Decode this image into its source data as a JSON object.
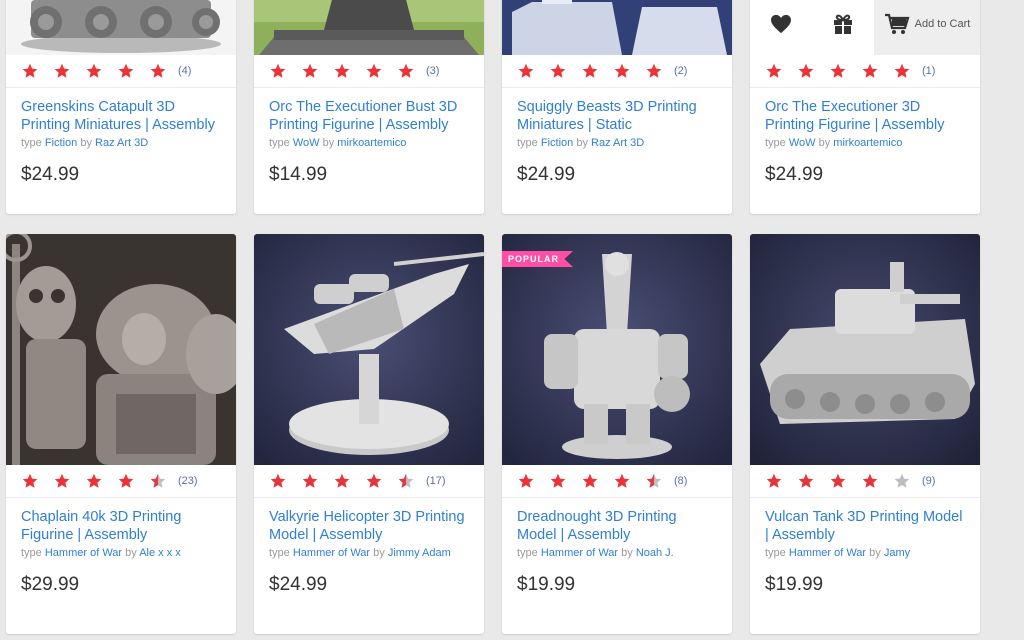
{
  "colors": {
    "star": "#e8353c",
    "star_empty": "#bdbdbd",
    "link": "#2f7fd3",
    "badge": "#ff4fa4"
  },
  "actions": {
    "add_to_cart": "Add to Cart"
  },
  "products": [
    {
      "title": "Greenskins Catapult 3D Printing Miniatures | Assembly",
      "type_label": "type",
      "type": "Fiction",
      "by_label": "by",
      "author": "Raz Art 3D",
      "price": "$24.99",
      "rating": 5,
      "count": "(4)"
    },
    {
      "title": "Orc The Executioner Bust 3D Printing Figurine | Assembly",
      "type_label": "type",
      "type": "WoW",
      "by_label": "by",
      "author": "mirkoartemico",
      "price": "$14.99",
      "rating": 5,
      "count": "(3)"
    },
    {
      "title": "Squiggly Beasts 3D Printing Miniatures | Static",
      "type_label": "type",
      "type": "Fiction",
      "by_label": "by",
      "author": "Raz Art 3D",
      "price": "$24.99",
      "rating": 5,
      "count": "(2)"
    },
    {
      "title": "Orc The Executioner 3D Printing Figurine | Assembly",
      "type_label": "type",
      "type": "WoW",
      "by_label": "by",
      "author": "mirkoartemico",
      "price": "$24.99",
      "rating": 5,
      "count": "(1)"
    },
    {
      "title": "Chaplain 40k 3D Printing Figurine | Assembly",
      "type_label": "type",
      "type": "Hammer of War",
      "by_label": "by",
      "author": "Ale x x x",
      "price": "$29.99",
      "rating": 4.5,
      "count": "(23)"
    },
    {
      "title": "Valkyrie Helicopter 3D Printing Model | Assembly",
      "type_label": "type",
      "type": "Hammer of War",
      "by_label": "by",
      "author": "Jimmy Adam",
      "price": "$24.99",
      "rating": 4.5,
      "count": "(17)"
    },
    {
      "title": "Dreadnought 3D Printing Model | Assembly",
      "type_label": "type",
      "type": "Hammer of War",
      "by_label": "by",
      "author": "Noah J.",
      "price": "$19.99",
      "rating": 4.5,
      "count": "(8)",
      "badge": "POPULAR"
    },
    {
      "title": "Vulcan Tank 3D Printing Model | Assembly",
      "type_label": "type",
      "type": "Hammer of War",
      "by_label": "by",
      "author": "Jamy",
      "price": "$19.99",
      "rating": 4,
      "count": "(9)"
    }
  ]
}
